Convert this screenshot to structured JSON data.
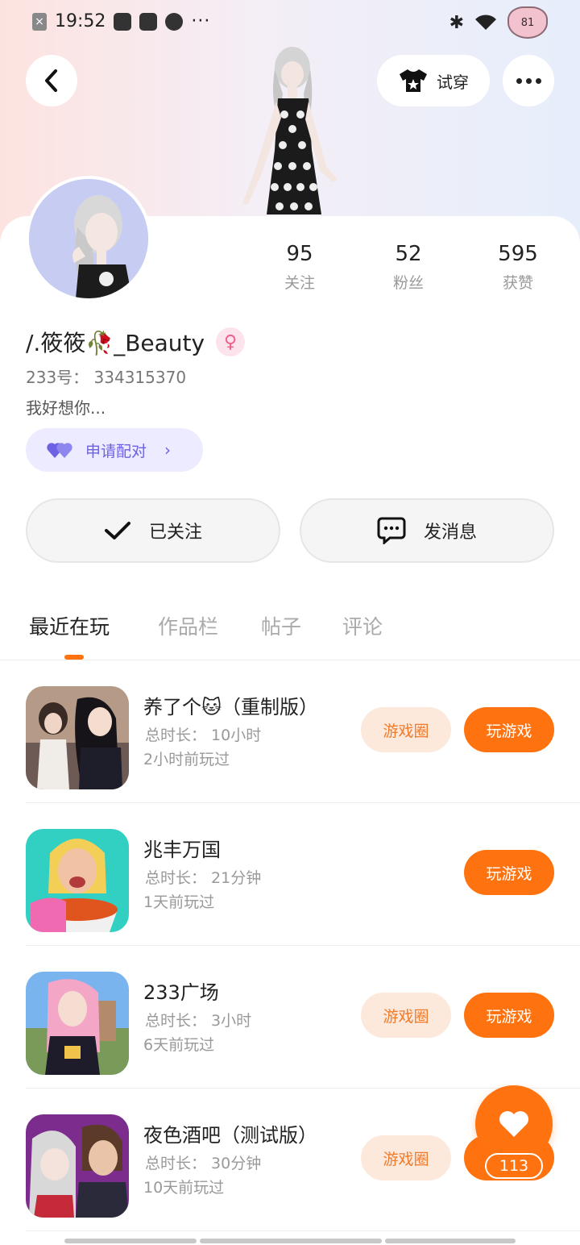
{
  "status_bar": {
    "time": "19:52",
    "dots": "···",
    "battery": "81"
  },
  "header": {
    "try_on_label": "试穿"
  },
  "profile": {
    "stats": [
      {
        "value": "95",
        "label": "关注"
      },
      {
        "value": "52",
        "label": "粉丝"
      },
      {
        "value": "595",
        "label": "获赞"
      }
    ],
    "username": "/.筱筱🥀_Beauty",
    "gender_symbol": "♀",
    "uid": "233号： 334315370",
    "bio": "我好想你...",
    "pair_label": "申请配对",
    "follow_label": "已关注",
    "message_label": "发消息"
  },
  "tabs": [
    {
      "label": "最近在玩"
    },
    {
      "label": "作品栏"
    },
    {
      "label": "帖子"
    },
    {
      "label": "评论"
    }
  ],
  "games": [
    {
      "title": "养了个🐱（重制版）",
      "duration": "总时长： 10小时",
      "last_played": "2小时前玩过",
      "circle_label": "游戏圈",
      "play_label": "玩游戏"
    },
    {
      "title": "兆丰万国",
      "duration": "总时长： 21分钟",
      "last_played": "1天前玩过",
      "play_label": "玩游戏"
    },
    {
      "title": "233广场",
      "duration": "总时长： 3小时",
      "last_played": "6天前玩过",
      "circle_label": "游戏圈",
      "play_label": "玩游戏"
    },
    {
      "title": "夜色酒吧（测试版）",
      "duration": "总时长： 30分钟",
      "last_played": "10天前玩过",
      "circle_label": "游戏圈",
      "play_label": "玩"
    }
  ],
  "floating_like": {
    "count": "113"
  },
  "colors": {
    "accent": "#ff7210",
    "pair_purple": "#6d62e4"
  }
}
